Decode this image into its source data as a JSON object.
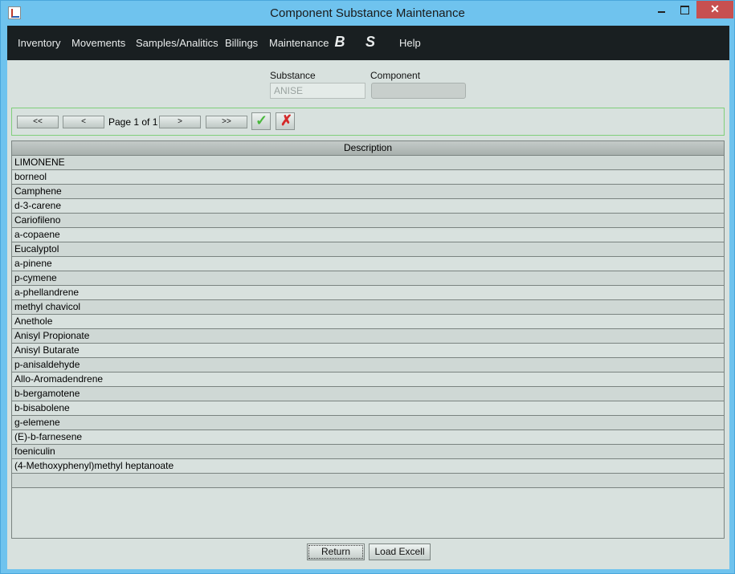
{
  "window": {
    "title": "Component Substance Maintenance",
    "close_glyph": "✕"
  },
  "menu": {
    "items": [
      "Inventory",
      "Movements",
      "Samples/Analitics",
      "Billings",
      "Maintenance",
      "Help"
    ],
    "icon_b": "B",
    "icon_s": "S"
  },
  "form": {
    "substance_label": "Substance",
    "substance_value": "ANISE",
    "component_label": "Component",
    "component_value": ""
  },
  "pager": {
    "first_label": "<<",
    "prev_label": "<",
    "page_text": "Page 1 of 1",
    "next_label": ">",
    "last_label": ">>"
  },
  "table": {
    "header": "Description",
    "rows": [
      "LIMONENE",
      "borneol",
      "Camphene",
      "d-3-carene",
      "Cariofileno",
      "a-copaene",
      "Eucalyptol",
      "a-pinene",
      "p-cymene",
      "a-phellandrene",
      "methyl chavicol",
      "Anethole",
      "Anisyl Propionate",
      "Anisyl Butarate",
      "p-anisaldehyde",
      "Allo-Aromadendrene",
      "b-bergamotene",
      "b-bisabolene",
      "g-elemene",
      "(E)-b-farnesene",
      "foeniculin",
      "(4-Methoxyphenyl)methyl heptanoate",
      ""
    ]
  },
  "buttons": {
    "return_label": "Return",
    "load_excel_label": "Load Excell"
  },
  "colors": {
    "titlebar": "#6fc3ee",
    "menubar": "#191f21",
    "panel": "#d8e1de",
    "close": "#c75050",
    "ok": "#49b83d",
    "cancel": "#d42a2a"
  }
}
